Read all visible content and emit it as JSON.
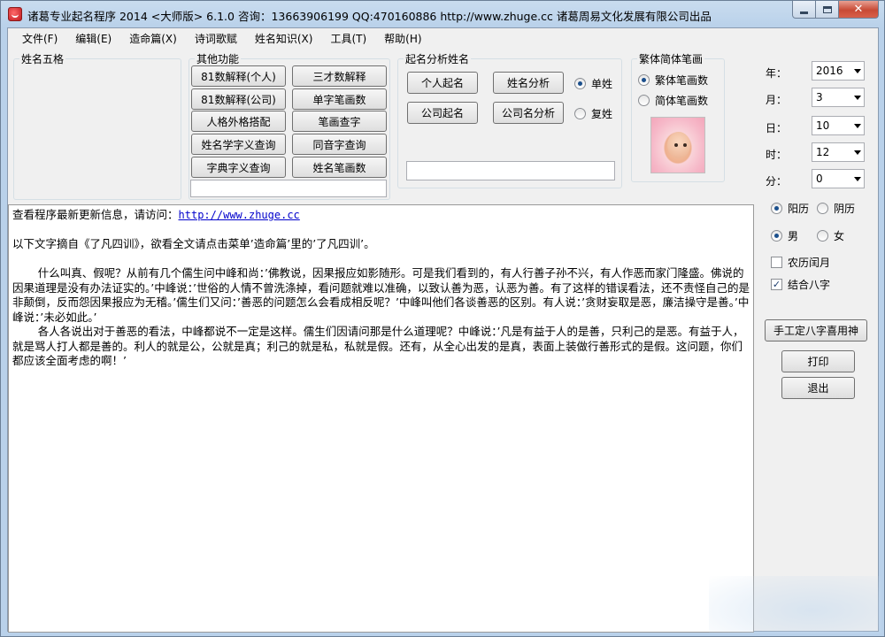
{
  "window": {
    "title": "诸葛专业起名程序 2014 <大师版> 6.1.0   咨询：13663906199 QQ:470160886  http://www.zhuge.cc   诸葛周易文化发展有限公司出品",
    "min_icon": "minimize-icon",
    "max_icon": "maximize-icon",
    "close_label": "✕"
  },
  "menu": {
    "items": [
      "文件(F)",
      "编辑(E)",
      "造命篇(X)",
      "诗词歌赋",
      "姓名知识(X)",
      "工具(T)",
      "帮助(H)"
    ]
  },
  "groups": {
    "wuge": {
      "title": "姓名五格"
    },
    "other": {
      "title": "其他功能",
      "buttons": [
        "81数解释(个人)",
        "三才数解释",
        "81数解释(公司)",
        "单字笔画数",
        "人格外格搭配",
        "笔画查字",
        "姓名学字义查询",
        "同音字查询",
        "字典字义查询",
        "姓名笔画数"
      ]
    },
    "analysis": {
      "title": "起名分析姓名",
      "buttons": [
        "个人起名",
        "姓名分析",
        "公司起名",
        "公司名分析"
      ],
      "radios": [
        "单姓",
        "复姓"
      ],
      "selected_radio": "单姓"
    },
    "stroke": {
      "title": "繁体简体笔画",
      "radios": [
        "繁体笔画数",
        "简体笔画数"
      ],
      "selected_radio": "繁体笔画数"
    }
  },
  "content": {
    "line1_prefix": "查看程序最新更新信息，请访问：",
    "line1_link": "http://www.zhuge.cc",
    "line2": "以下文字摘自《了凡四训》，欲看全文请点击菜单’造命篇’里的’了凡四训’。",
    "para1": "什么叫真、假呢？从前有几个儒生问中峰和尚：’佛教说，因果报应如影随形。可是我们看到的，有人行善子孙不兴，有人作恶而家门隆盛。佛说的因果道理是没有办法证实的。’中峰说：’世俗的人情不曾洗涤掉，看问题就难以准确，以致认善为恶，认恶为善。有了这样的错误看法，还不责怪自己的是非颠倒，反而怨因果报应为无稽。’儒生们又问：’善恶的问题怎么会看成相反呢？’中峰叫他们各谈善恶的区别。有人说：’贪财妄取是恶，廉洁操守是善。’中峰说：’未必如此。’",
    "para2": "各人各说出对于善恶的看法，中峰都说不一定是这样。儒生们因请问那是什么道理呢？中峰说：’凡是有益于人的是善，只利己的是恶。有益于人，就是骂人打人都是善的。利人的就是公，公就是真；利己的就是私，私就是假。还有，从全心出发的是真，表面上装做行善形式的是假。这问题，你们都应该全面考虑的啊！’"
  },
  "datetime": {
    "year_label": "年：",
    "year_value": "2016",
    "month_label": "月：",
    "month_value": "3",
    "day_label": "日：",
    "day_value": "10",
    "hour_label": "时：",
    "hour_value": "12",
    "minute_label": "分：",
    "minute_value": "0"
  },
  "calendar": {
    "radios": [
      "阳历",
      "阴历"
    ],
    "selected": "阳历"
  },
  "gender": {
    "radios": [
      "男",
      "女"
    ],
    "selected": "男"
  },
  "checks": [
    {
      "label": "农历闰月",
      "checked": false
    },
    {
      "label": "结合八字",
      "checked": true
    }
  ],
  "actions": {
    "bazi_button": "手工定八字喜用神",
    "print_button": "打印",
    "exit_button": "退出"
  },
  "colors": {
    "link": "#0000cc",
    "title_bar": "#b9d1ea"
  }
}
